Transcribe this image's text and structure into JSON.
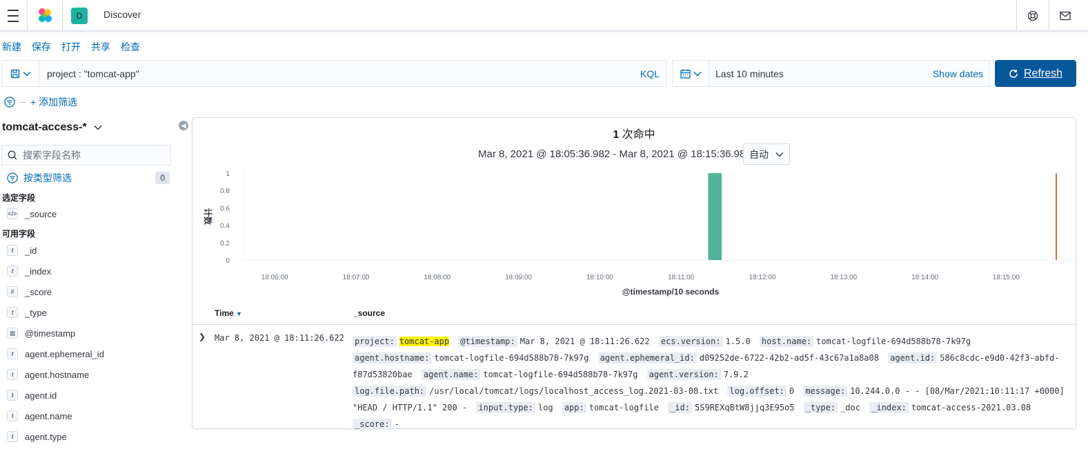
{
  "header": {
    "breadcrumb": "Discover",
    "space_initial": "D"
  },
  "menu": [
    "新建",
    "保存",
    "打开",
    "共享",
    "检查"
  ],
  "query": {
    "text": "project : \"tomcat-app\"",
    "language": "KQL"
  },
  "time": {
    "range": "Last 10 minutes",
    "show_dates": "Show dates",
    "refresh": "Refresh"
  },
  "filters": {
    "add": "+ 添加筛选"
  },
  "sidebar": {
    "index_pattern": "tomcat-access-*",
    "search_placeholder": "搜索字段名称",
    "filter_by_type": "按类型筛选",
    "filter_count": "0",
    "selected_header": "选定字段",
    "selected_fields": [
      {
        "name": "_source",
        "type": "source"
      }
    ],
    "available_header": "可用字段",
    "available_fields": [
      {
        "name": "_id",
        "type": "t"
      },
      {
        "name": "_index",
        "type": "t"
      },
      {
        "name": "_score",
        "type": "#"
      },
      {
        "name": "_type",
        "type": "t"
      },
      {
        "name": "@timestamp",
        "type": "date"
      },
      {
        "name": "agent.ephemeral_id",
        "type": "t"
      },
      {
        "name": "agent.hostname",
        "type": "t"
      },
      {
        "name": "agent.id",
        "type": "t"
      },
      {
        "name": "agent.name",
        "type": "t"
      },
      {
        "name": "agent.type",
        "type": "t"
      }
    ]
  },
  "results": {
    "hits": "1",
    "hits_label": "次命中",
    "time_range": "Mar 8, 2021 @ 18:05:36.982 - Mar 8, 2021 @ 18:15:36.982",
    "interval": "自动",
    "columns": {
      "time": "Time",
      "source": "_source"
    },
    "row": {
      "time": "Mar 8, 2021 @ 18:11:26.622",
      "fields": [
        {
          "k": "project:",
          "v": "tomcat-app",
          "hl": true
        },
        {
          "k": "@timestamp:",
          "v": "Mar 8, 2021 @ 18:11:26.622"
        },
        {
          "k": "ecs.version:",
          "v": "1.5.0"
        },
        {
          "k": "host.name:",
          "v": "tomcat-logfile-694d588b78-7k97g"
        },
        {
          "k": "agent.hostname:",
          "v": "tomcat-logfile-694d588b78-7k97g"
        },
        {
          "k": "agent.ephemeral_id:",
          "v": "d09252de-6722-42b2-ad5f-43c67a1a8a08"
        },
        {
          "k": "agent.id:",
          "v": "586c8cdc-e9d0-42f3-abfd-f87d53820bae"
        },
        {
          "k": "agent.name:",
          "v": "tomcat-logfile-694d588b78-7k97g"
        },
        {
          "k": "agent.version:",
          "v": "7.9.2"
        },
        {
          "k": "log.file.path:",
          "v": "/usr/local/tomcat/logs/localhost_access_log.2021-03-08.txt"
        },
        {
          "k": "log.offset:",
          "v": "0"
        },
        {
          "k": "message:",
          "v": "10.244.0.0 - - [08/Mar/2021:10:11:17 +0000] \"HEAD / HTTP/1.1\" 200 -"
        },
        {
          "k": "input.type:",
          "v": "log"
        },
        {
          "k": "app:",
          "v": "tomcat-logfile"
        },
        {
          "k": "_id:",
          "v": "5S9REXqBtW8jjq3E95o5"
        },
        {
          "k": "_type:",
          "v": "_doc"
        },
        {
          "k": "_index:",
          "v": "tomcat-access-2021.03.08"
        },
        {
          "k": "_score:",
          "v": "-"
        }
      ]
    }
  },
  "chart_data": {
    "type": "bar",
    "ylabel": "计数",
    "xlabel": "@timestamp/10 seconds",
    "x_ticks": [
      "18:06:00",
      "18:07:00",
      "18:08:00",
      "18:09:00",
      "18:10:00",
      "18:11:00",
      "18:12:00",
      "18:13:00",
      "18:14:00",
      "18:15:00"
    ],
    "y_ticks": [
      "0",
      "0.2",
      "0.4",
      "0.6",
      "0.8",
      "1"
    ],
    "ylim": [
      0,
      1
    ],
    "x_start": "18:05:36.982",
    "x_end": "18:15:36.982",
    "bars": [
      {
        "x": "18:11:20",
        "value": 1
      }
    ],
    "now_marker": "18:15:36.982",
    "bar_color": "#54b399",
    "marker_color": "#e7664c"
  }
}
